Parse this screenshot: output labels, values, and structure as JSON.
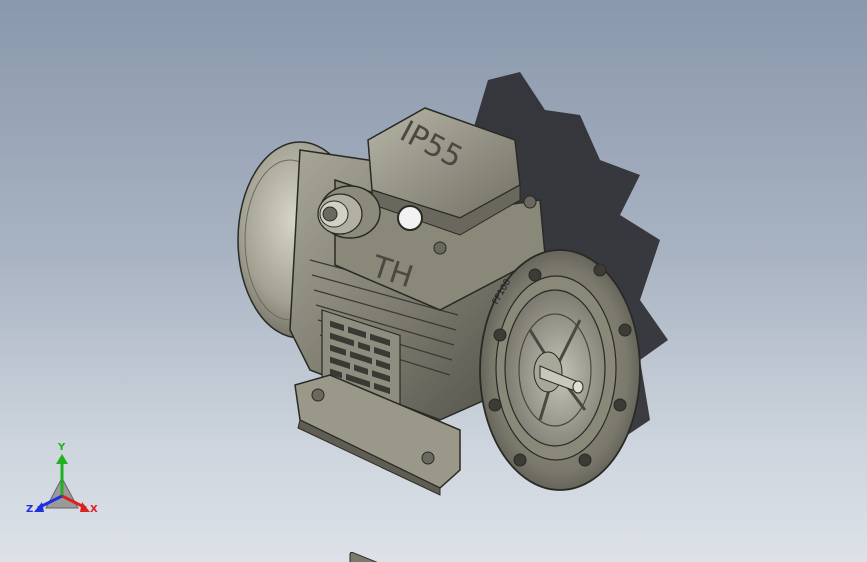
{
  "model": {
    "terminal_box_marking": "IP55",
    "brand_marking": "TH",
    "flange_marking": "FF100"
  },
  "triad": {
    "y_label": "Y",
    "z_label": "Z",
    "x_label": "X"
  },
  "colors": {
    "background_top": "#8a98ac",
    "background_bottom": "#dde2e8",
    "part_metal": "#8c8a7a",
    "shadow": "#2b2b30",
    "axis_x": "#e02020",
    "axis_y": "#20b020",
    "axis_z": "#2030e0"
  }
}
